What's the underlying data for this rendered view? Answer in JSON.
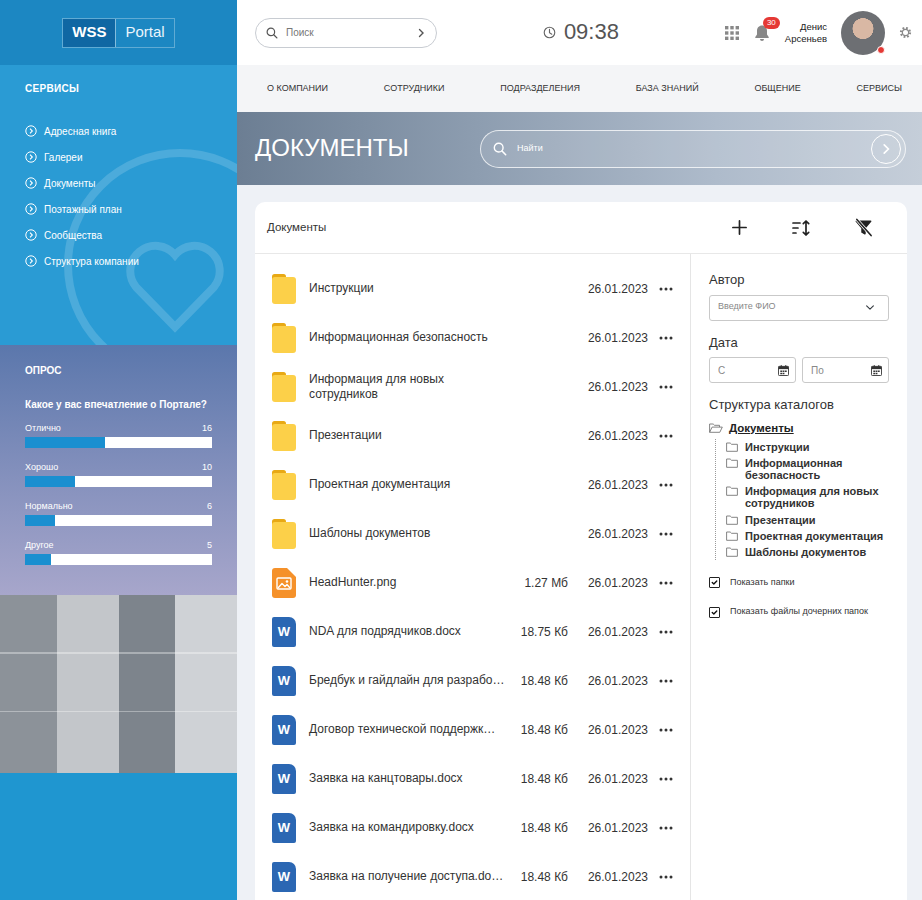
{
  "logo": {
    "brand": "WSS",
    "product": "Portal"
  },
  "sidebar": {
    "title": "СЕРВИСЫ",
    "items": [
      {
        "label": "Адресная книга",
        "selected": false
      },
      {
        "label": "Галереи",
        "selected": false
      },
      {
        "label": "Документы",
        "selected": false
      },
      {
        "label": "Поэтажный план",
        "selected": false
      },
      {
        "label": "Сообщества",
        "selected": false
      },
      {
        "label": "Структура компании",
        "selected": false
      }
    ]
  },
  "poll": {
    "title": "ОПРОС",
    "question": "Какое у вас впечатление о Портале?",
    "options": [
      {
        "label": "Отлично",
        "count": "16",
        "level": 0.43
      },
      {
        "label": "Хорошо",
        "count": "10",
        "level": 0.27
      },
      {
        "label": "Нормально",
        "count": "6",
        "level": 0.16
      },
      {
        "label": "Другое",
        "count": "5",
        "level": 0.14
      }
    ]
  },
  "header": {
    "search": {
      "placeholder": "Поиск"
    },
    "time": "09:38",
    "notifications": "30",
    "user": {
      "first_name": "Денис",
      "last_name": "Арсеньев"
    }
  },
  "nav": [
    {
      "label": "О КОМПАНИИ",
      "selected": false
    },
    {
      "label": "СОТРУДНИКИ",
      "selected": false
    },
    {
      "label": "ПОДРАЗДЕЛЕНИЯ",
      "selected": false
    },
    {
      "label": "БАЗА ЗНАНИЙ",
      "selected": false
    },
    {
      "label": "ОБЩЕНИЕ",
      "selected": false
    },
    {
      "label": "СЕРВИСЫ",
      "selected": false
    }
  ],
  "page": {
    "title": "ДОКУМЕНТЫ",
    "search": {
      "placeholder": "Найти"
    }
  },
  "documents": {
    "title": "Документы",
    "rows": [
      {
        "kind": "folder",
        "name": "Инструкции",
        "date": "26.01.2023"
      },
      {
        "kind": "folder",
        "name": "Информационная безопасность",
        "date": "26.01.2023"
      },
      {
        "kind": "folder",
        "name": "Информация для новых сотрудников",
        "date": "26.01.2023"
      },
      {
        "kind": "folder",
        "name": "Презентации",
        "date": "26.01.2023"
      },
      {
        "kind": "folder",
        "name": "Проектная документация",
        "date": "26.01.2023"
      },
      {
        "kind": "folder",
        "name": "Шаблоны документов",
        "date": "26.01.2023"
      },
      {
        "kind": "image",
        "name": "HeadHunter.png",
        "size": "1.27 Мб",
        "date": "26.01.2023"
      },
      {
        "kind": "word",
        "icon_text": "W",
        "name": "NDA для подрядчиков.docx",
        "size": "18.75 Кб",
        "date": "26.01.2023"
      },
      {
        "kind": "word",
        "icon_text": "W",
        "name": "Бредбук и гайдлайн для разрабо…",
        "size": "18.48 Кб",
        "date": "26.01.2023"
      },
      {
        "kind": "word",
        "icon_text": "W",
        "name": "Договор технической поддержк…",
        "size": "18.48 Кб",
        "date": "26.01.2023"
      },
      {
        "kind": "word",
        "icon_text": "W",
        "name": "Заявка на канцтовары.docx",
        "size": "18.48 Кб",
        "date": "26.01.2023"
      },
      {
        "kind": "word",
        "icon_text": "W",
        "name": "Заявка на командировку.docx",
        "size": "18.48 Кб",
        "date": "26.01.2023"
      },
      {
        "kind": "word",
        "icon_text": "W",
        "name": "Заявка на получение доступа.do…",
        "size": "18.48 Кб",
        "date": "26.01.2023"
      }
    ]
  },
  "filters": {
    "author": {
      "label": "Автор",
      "placeholder": "Введите ФИО"
    },
    "date": {
      "label": "Дата",
      "from": "С",
      "to": "По"
    },
    "tree": {
      "title": "Структура каталогов",
      "root": {
        "label": "Документы",
        "expanded": true,
        "selected": true
      },
      "children": [
        {
          "label": "Инструкции",
          "selected": false
        },
        {
          "label": "Информационная безопасность",
          "selected": false
        },
        {
          "label": "Информация для новых сотрудников",
          "selected": false
        },
        {
          "label": "Презентации",
          "selected": false
        },
        {
          "label": "Проектная документация",
          "selected": false
        },
        {
          "label": "Шаблоны документов",
          "selected": false
        }
      ]
    },
    "options": [
      {
        "label": "Показать папки",
        "checked": true
      },
      {
        "label": "Показать файлы дочерних папок",
        "checked": true
      }
    ]
  }
}
